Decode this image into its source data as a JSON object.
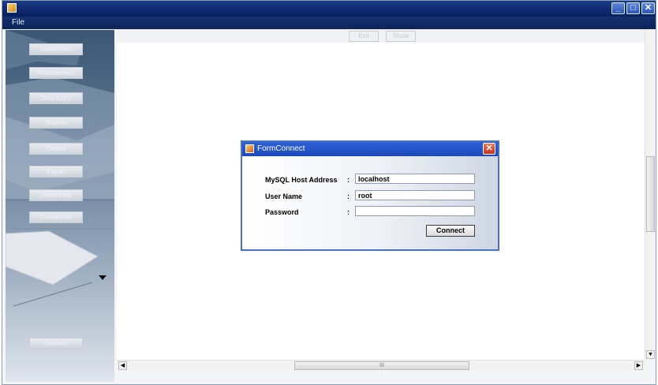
{
  "window": {
    "menu_file": "File"
  },
  "sidebar": {
    "buttons": [
      "Dashboard",
      "Relationships",
      "Data Entry",
      "Reports",
      "Control",
      "Export",
      "Predefined",
      "Conversion"
    ],
    "bottom_button": "Connect"
  },
  "toolbar": {
    "buttons": [
      "Exit",
      "Show"
    ]
  },
  "dialog": {
    "title": "FormConnect",
    "fields": [
      {
        "label": "MySQL Host Address",
        "colon": ":",
        "value": "localhost"
      },
      {
        "label": "User Name",
        "colon": ":",
        "value": "root"
      },
      {
        "label": "Password",
        "colon": ":",
        "value": ""
      }
    ],
    "connect_label": "Connect"
  },
  "scroll": {
    "h_thumb_grip": "III"
  }
}
